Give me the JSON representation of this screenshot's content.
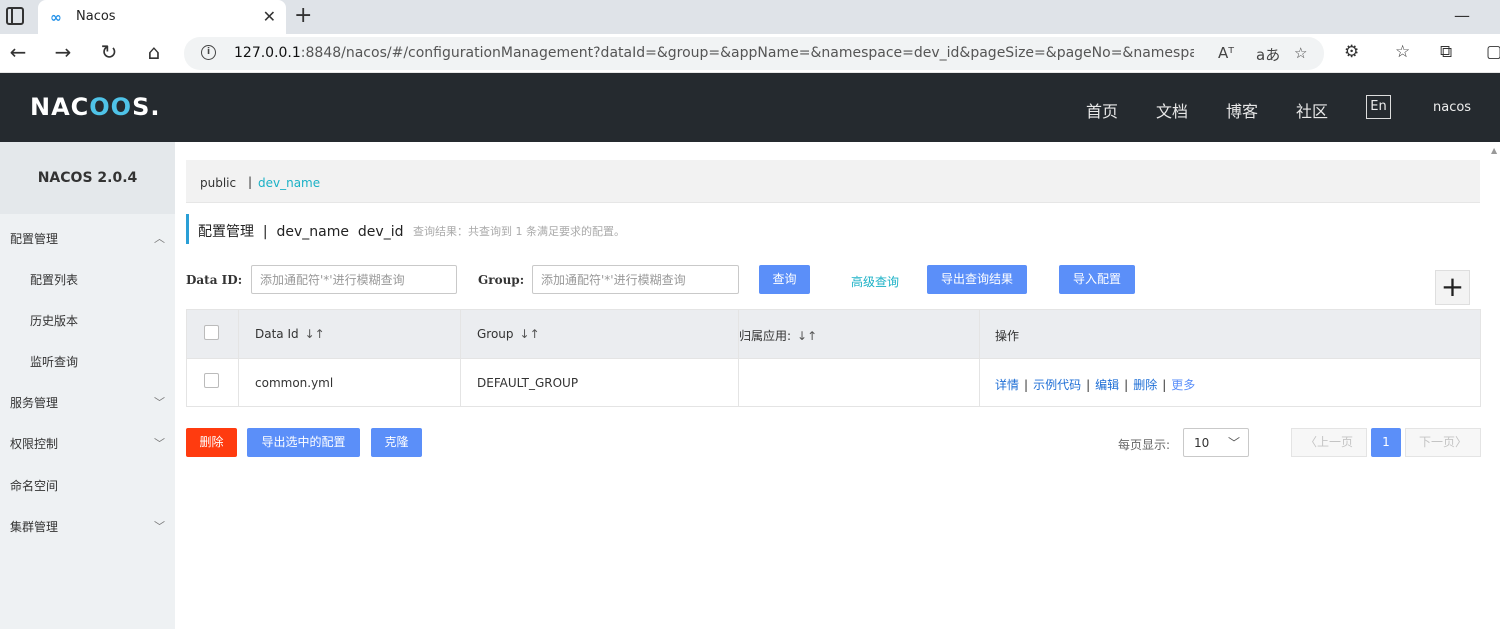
{
  "browser": {
    "tab_title": "Nacos",
    "tab_icon": "∞",
    "url_host": "127.0.0.1",
    "url_rest": ":8848/nacos/#/configurationManagement?dataId=&group=&appName=&namespace=dev_id&pageSize=&pageNo=&namespaceShowNam...",
    "read_aloud": "Aᵀ",
    "translate": "aあ"
  },
  "header": {
    "logo_left": "NAC",
    "logo_oo": "OO",
    "logo_right": "S.",
    "nav": [
      "首页",
      "文档",
      "博客",
      "社区"
    ],
    "lang": "En",
    "user": "nacos"
  },
  "sidebar": {
    "title": "NACOS 2.0.4",
    "items": [
      {
        "label": "配置管理"
      },
      {
        "label": "配置列表"
      },
      {
        "label": "历史版本"
      },
      {
        "label": "监听查询"
      },
      {
        "label": "服务管理"
      },
      {
        "label": "权限控制"
      },
      {
        "label": "命名空间"
      },
      {
        "label": "集群管理"
      }
    ]
  },
  "namespace": {
    "public": "public",
    "separator": "|",
    "current": "dev_name"
  },
  "page": {
    "title": "配置管理  |  dev_name  dev_id",
    "hint": "查询结果：共查询到 1 条满足要求的配置。"
  },
  "search": {
    "dataid_label": "Data ID:",
    "dataid_placeholder": "添加通配符'*'进行模糊查询",
    "group_label": "Group:",
    "group_placeholder": "添加通配符'*'进行模糊查询",
    "query_btn": "查询",
    "advanced": "高级查询",
    "export_btn": "导出查询结果",
    "import_btn": "导入配置",
    "add_btn": "+"
  },
  "table": {
    "headers": {
      "data_id": "Data Id",
      "group": "Group",
      "app": "归属应用:",
      "ops": "操作"
    },
    "sort_icon": "↓↑",
    "rows": [
      {
        "data_id": "common.yml",
        "group": "DEFAULT_GROUP",
        "app": "",
        "ops": {
          "detail": "详情",
          "sample": "示例代码",
          "edit": "编辑",
          "delete": "删除",
          "more": "更多"
        }
      }
    ]
  },
  "footer": {
    "delete_btn": "删除",
    "export_selected_btn": "导出选中的配置",
    "clone_btn": "克隆",
    "page_size_label": "每页显示:",
    "page_size": "10",
    "prev": "上一页",
    "current_page": "1",
    "next": "下一页"
  }
}
